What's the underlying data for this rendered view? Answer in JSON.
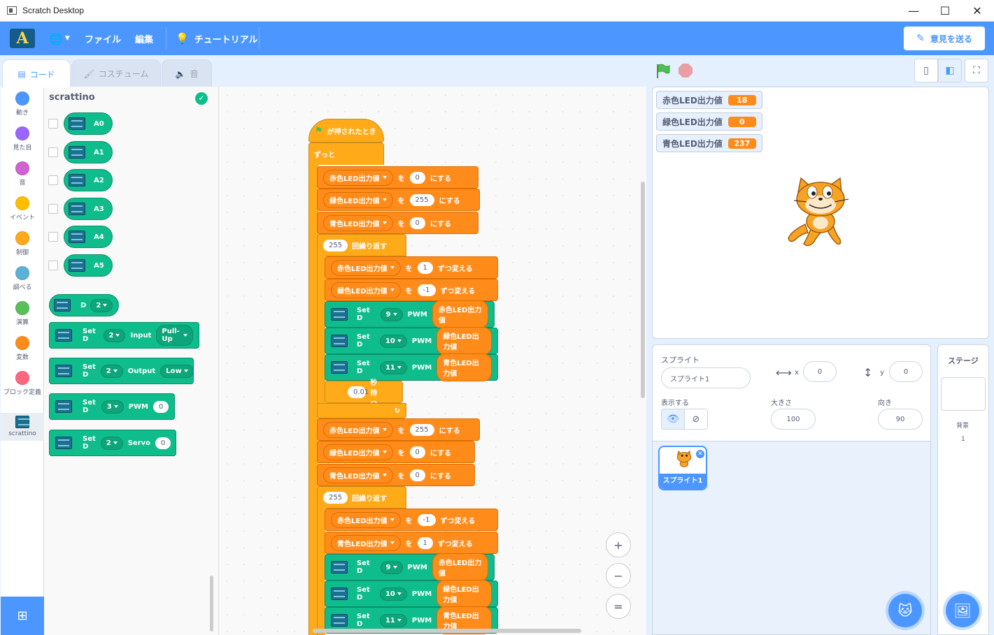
{
  "window": {
    "title": "Scratch Desktop",
    "minimize": "—",
    "maximize": "☐",
    "close": "✕"
  },
  "menu": {
    "logo": "A",
    "globe": "🌐",
    "file": "ファイル",
    "edit": "編集",
    "tutorials": "チュートリアル",
    "feedback": "意見を送る"
  },
  "tabs": {
    "code": "コード",
    "costumes": "コスチューム",
    "sounds": "音"
  },
  "categories": [
    {
      "label": "動き",
      "color": "#4c97ff"
    },
    {
      "label": "見た目",
      "color": "#9966ff"
    },
    {
      "label": "音",
      "color": "#cf63cf"
    },
    {
      "label": "イベント",
      "color": "#ffbf00"
    },
    {
      "label": "制御",
      "color": "#ffab19"
    },
    {
      "label": "調べる",
      "color": "#5cb1d6"
    },
    {
      "label": "演算",
      "color": "#59c059"
    },
    {
      "label": "変数",
      "color": "#ff8c1a"
    },
    {
      "label": "ブロック定義",
      "color": "#ff6680"
    },
    {
      "label": "scrattino",
      "color": "#1d6f8f"
    }
  ],
  "palette": {
    "title": "scrattino",
    "analog": [
      "A0",
      "A1",
      "A2",
      "A3",
      "A4",
      "A5"
    ],
    "digital_reporter": {
      "label": "D",
      "value": "2"
    },
    "set_input": {
      "label": "Set D",
      "pin": "2",
      "mode_label": "Input",
      "mode": "Pull-Up"
    },
    "set_output": {
      "label": "Set D",
      "pin": "2",
      "mode_label": "Output",
      "mode": "Low"
    },
    "set_pwm": {
      "label": "Set D",
      "pin": "3",
      "mode_label": "PWM",
      "value": "0"
    },
    "set_servo": {
      "label": "Set D",
      "pin": "2",
      "mode_label": "Servo",
      "value": "0"
    }
  },
  "script": {
    "hat": "が押されたとき",
    "forever": "ずっと",
    "to": "を",
    "set": "にする",
    "change": "ずつ変える",
    "repeat": "回繰り返す",
    "wait": "秒待つ",
    "setd": "Set D",
    "pwm": "PWM",
    "vars": {
      "red": "赤色LED出力値",
      "green": "緑色LED出力値",
      "blue": "青色LED出力値"
    },
    "set1": {
      "red": "0",
      "green": "255",
      "blue": "0"
    },
    "repeat1": "255",
    "change1": {
      "red": "1",
      "green": "-1"
    },
    "pins": {
      "r": "9",
      "g": "10",
      "b": "11"
    },
    "wait_value": "0.01",
    "set2": {
      "red": "255",
      "green": "0",
      "blue": "0"
    },
    "repeat2": "255",
    "change2": {
      "red": "-1",
      "blue": "1"
    }
  },
  "zoom": {
    "in": "+",
    "out": "−",
    "reset": "="
  },
  "stage": {
    "monitors": [
      {
        "label": "赤色LED出力値",
        "value": "18"
      },
      {
        "label": "緑色LED出力値",
        "value": "0"
      },
      {
        "label": "青色LED出力値",
        "value": "237"
      }
    ]
  },
  "sprite": {
    "section": "スプライト",
    "name": "スプライト1",
    "x_label": "x",
    "x": "0",
    "y_label": "y",
    "y": "0",
    "show_label": "表示する",
    "size_label": "大きさ",
    "size": "100",
    "direction_label": "向き",
    "direction": "90",
    "thumb_name": "スプライト1"
  },
  "stage_pane": {
    "title": "ステージ",
    "backdrops_label": "背景",
    "backdrops_count": "1"
  }
}
